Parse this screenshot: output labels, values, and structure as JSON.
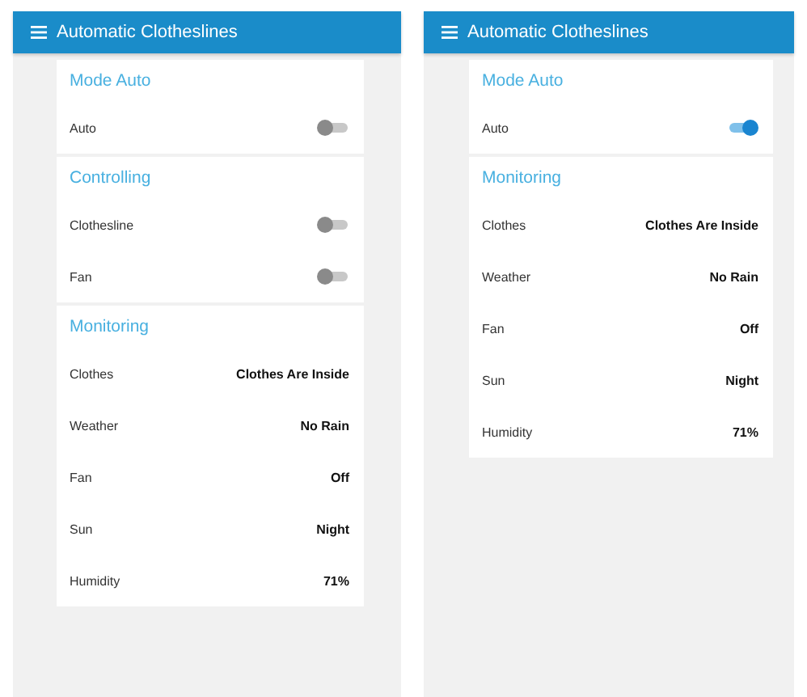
{
  "screens": [
    {
      "title": "Automatic Clotheslines",
      "sections": [
        {
          "heading": "Mode Auto",
          "rows": [
            {
              "kind": "switch",
              "label": "Auto",
              "on": false
            }
          ]
        },
        {
          "heading": "Controlling",
          "rows": [
            {
              "kind": "switch",
              "label": "Clothesline",
              "on": false
            },
            {
              "kind": "switch",
              "label": "Fan",
              "on": false
            }
          ]
        },
        {
          "heading": "Monitoring",
          "rows": [
            {
              "kind": "value",
              "label": "Clothes",
              "value": "Clothes Are Inside"
            },
            {
              "kind": "value",
              "label": "Weather",
              "value": "No Rain"
            },
            {
              "kind": "value",
              "label": "Fan",
              "value": "Off"
            },
            {
              "kind": "value",
              "label": "Sun",
              "value": "Night"
            },
            {
              "kind": "value",
              "label": "Humidity",
              "value": "71%"
            }
          ]
        }
      ]
    },
    {
      "title": "Automatic Clotheslines",
      "sections": [
        {
          "heading": "Mode Auto",
          "rows": [
            {
              "kind": "switch",
              "label": "Auto",
              "on": true
            }
          ]
        },
        {
          "heading": "Monitoring",
          "rows": [
            {
              "kind": "value",
              "label": "Clothes",
              "value": "Clothes Are Inside"
            },
            {
              "kind": "value",
              "label": "Weather",
              "value": "No Rain"
            },
            {
              "kind": "value",
              "label": "Fan",
              "value": "Off"
            },
            {
              "kind": "value",
              "label": "Sun",
              "value": "Night"
            },
            {
              "kind": "value",
              "label": "Humidity",
              "value": "71%"
            }
          ]
        }
      ]
    }
  ]
}
